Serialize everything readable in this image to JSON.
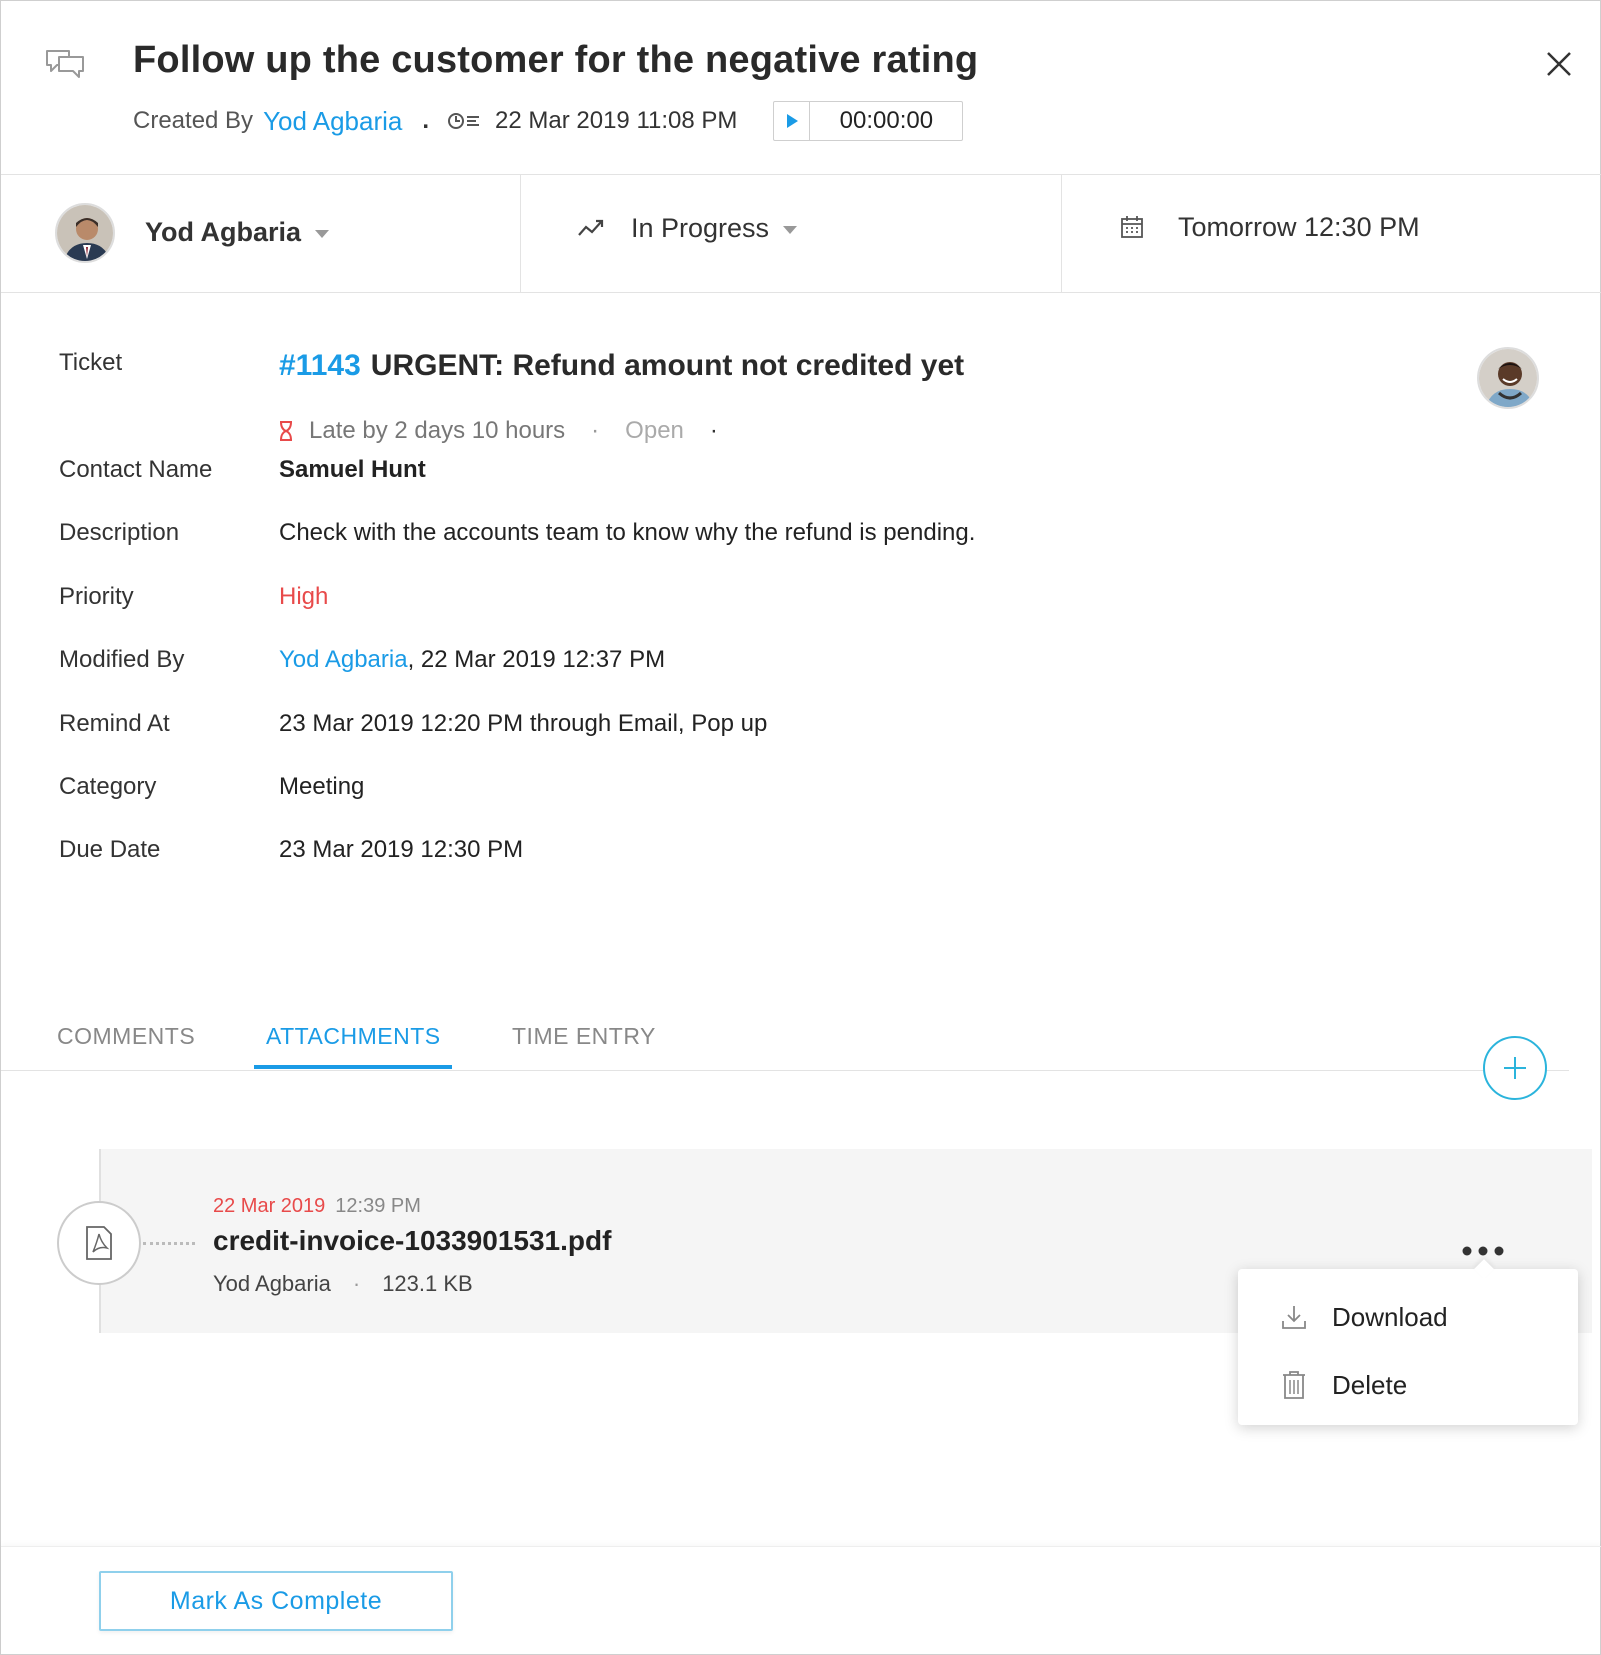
{
  "header": {
    "title": "Follow up the customer for the negative rating",
    "created_by_label": "Created By",
    "created_by": "Yod Agbaria",
    "separator": ".",
    "created_at": "22 Mar 2019 11:08 PM",
    "timer": "00:00:00"
  },
  "strip": {
    "owner": "Yod Agbaria",
    "status": "In Progress",
    "due": "Tomorrow 12:30 PM"
  },
  "details": {
    "ticket_label": "Ticket",
    "ticket_number": "#1143",
    "ticket_subject": "URGENT: Refund amount not credited yet",
    "late_text": "Late by 2 days 10 hours",
    "dot": "·",
    "ticket_status": "Open",
    "fields": [
      {
        "label": "Contact Name",
        "value": "Samuel Hunt"
      },
      {
        "label": "Description",
        "value": "Check with the accounts team to know why the refund is pending."
      },
      {
        "label": "Priority",
        "value": "High"
      },
      {
        "label": "Modified By",
        "value": "22 Mar 2019 12:37 PM",
        "user": "Yod Agbaria",
        "joiner": ", "
      },
      {
        "label": "Remind At",
        "value": "23 Mar 2019 12:20 PM through Email, Pop up"
      },
      {
        "label": "Category",
        "value": "Meeting"
      },
      {
        "label": "Due Date",
        "value": "23 Mar 2019 12:30 PM"
      }
    ]
  },
  "tabs": [
    {
      "label": "COMMENTS"
    },
    {
      "label": "ATTACHMENTS"
    },
    {
      "label": "TIME ENTRY"
    }
  ],
  "active_tab": "ATTACHMENTS",
  "attachment": {
    "date": "22 Mar 2019",
    "time": "12:39 PM",
    "filename": "credit-invoice-1033901531.pdf",
    "uploader": "Yod Agbaria",
    "dot": "·",
    "size": "123.1 KB"
  },
  "menu": {
    "download": "Download",
    "delete": "Delete"
  },
  "footer": {
    "complete_label": "Mark As Complete"
  },
  "colors": {
    "accent": "#1a9be6",
    "danger": "#e84a4a",
    "muted": "#888888"
  }
}
